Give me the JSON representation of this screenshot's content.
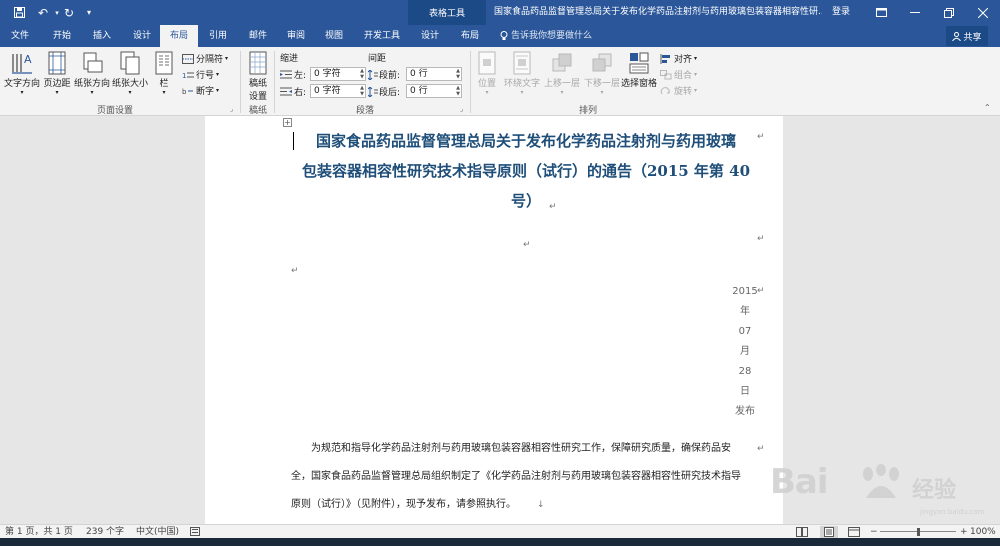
{
  "titlebar": {
    "table_tools": "表格工具",
    "title": "国家食品药品监督管理总局关于发布化学药品注射剂与药用玻璃包装容器相容性研...",
    "login": "登录"
  },
  "tabs": [
    {
      "label": "文件"
    },
    {
      "label": "开始"
    },
    {
      "label": "插入"
    },
    {
      "label": "设计"
    },
    {
      "label": "布局"
    },
    {
      "label": "引用"
    },
    {
      "label": "邮件"
    },
    {
      "label": "审阅"
    },
    {
      "label": "视图"
    },
    {
      "label": "开发工具"
    },
    {
      "label": "设计"
    },
    {
      "label": "布局"
    }
  ],
  "tell_me": "告诉我你想要做什么",
  "share": "共享",
  "ribbon": {
    "page_setup": {
      "text_direction": "文字方向",
      "margins": "页边距",
      "orientation": "纸张方向",
      "size": "纸张大小",
      "columns": "栏",
      "breaks": "分隔符",
      "line_numbers": "行号",
      "hyphenation": "断字",
      "group_label": "页面设置"
    },
    "manuscript": {
      "button_line1": "稿纸",
      "button_line2": "设置",
      "group_label": "稿纸"
    },
    "paragraph": {
      "indent_label": "缩进",
      "spacing_label": "间距",
      "left_label": "左:",
      "right_label": "右:",
      "before_label": "段前:",
      "after_label": "段后:",
      "left_value": "0 字符",
      "right_value": "0 字符",
      "before_value": "0 行",
      "after_value": "0 行",
      "group_label": "段落"
    },
    "arrange": {
      "position": "位置",
      "wrap_text": "环绕文字",
      "bring_forward": "上移一层",
      "send_backward": "下移一层",
      "selection_pane": "选择窗格",
      "align": "对齐",
      "group": "组合",
      "rotate": "旋转",
      "group_label": "排列"
    }
  },
  "document": {
    "title_line1": "国家食品药品监督管理总局关于发布化学药品注射剂与药用玻璃",
    "title_line2": "包装容器相容性研究技术指导原则（试行）的通告（2015 年第 40",
    "title_line3": "号）",
    "date": [
      "2015",
      "年",
      "07",
      "月",
      "28",
      "日",
      "发布"
    ],
    "para1_line1": "为规范和指导化学药品注射剂与药用玻璃包装容器相容性研究工作，保障研究质量，确保药品安",
    "para1_line2": "全，国家食品药品监督管理总局组织制定了《化学药品注射剂与药用玻璃包装容器相容性研究技术指导",
    "para1_line3": "原则（试行）》（见附件），现予发布，请参照执行。"
  },
  "statusbar": {
    "page": "第 1 页，共 1 页",
    "words": "239 个字",
    "language": "中文(中国)",
    "zoom": "100%",
    "zoom_level": 0.5
  },
  "watermark": {
    "brand": "Bai",
    "cn": "经验",
    "url": "jingyan.baidu.com"
  },
  "colors": {
    "accent": "#2b579a",
    "title_text": "#1f4e79"
  }
}
